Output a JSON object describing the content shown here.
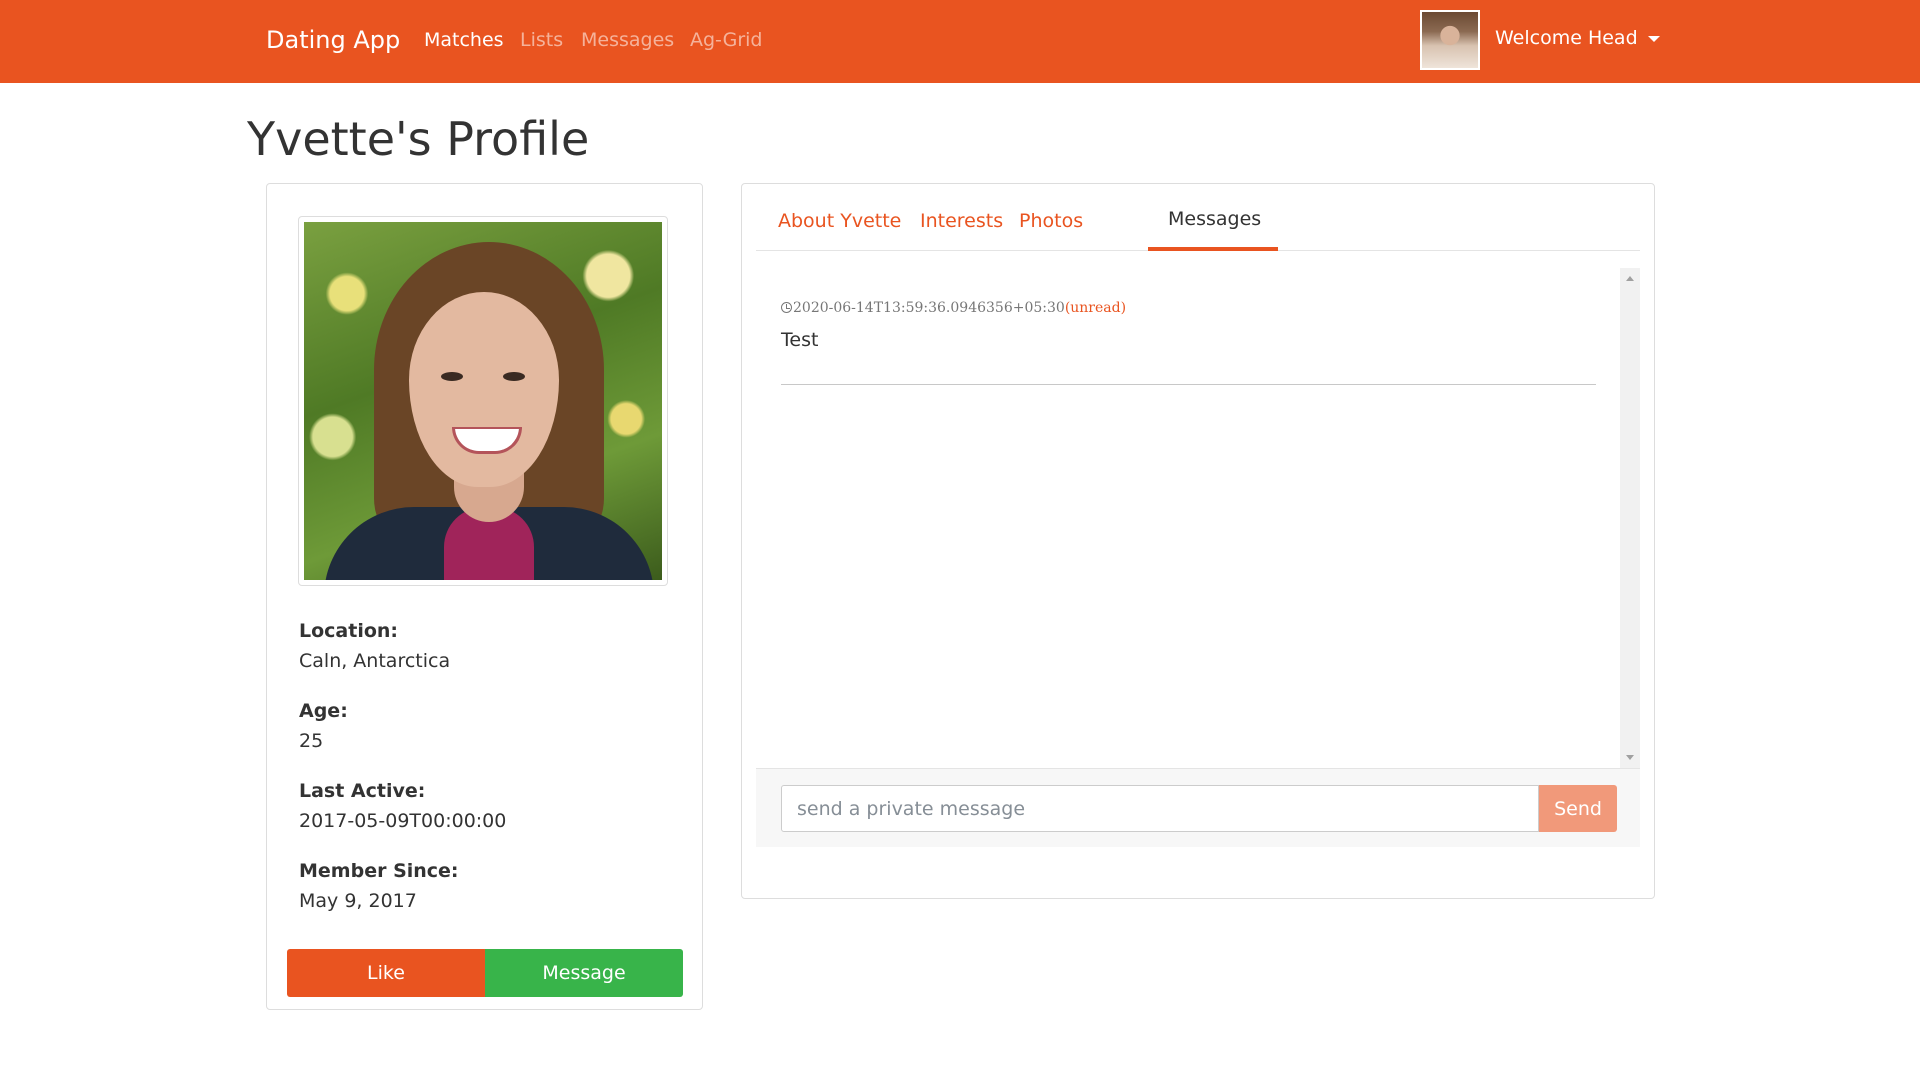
{
  "navbar": {
    "brand": "Dating App",
    "links": [
      {
        "label": "Matches",
        "active": true
      },
      {
        "label": "Lists",
        "active": false
      },
      {
        "label": "Messages",
        "active": false
      },
      {
        "label": "Ag-Grid",
        "active": false
      }
    ],
    "welcome": "Welcome Head",
    "accent_color": "#e95420"
  },
  "page": {
    "title": "Yvette's Profile"
  },
  "profile": {
    "details": [
      {
        "label": "Location:",
        "value": "Caln, Antarctica"
      },
      {
        "label": "Age:",
        "value": "25"
      },
      {
        "label": "Last Active:",
        "value": "2017-05-09T00:00:00"
      },
      {
        "label": "Member Since:",
        "value": "May 9, 2017"
      }
    ],
    "like_label": "Like",
    "message_label": "Message",
    "like_color": "#e95420",
    "message_color": "#38b44a"
  },
  "tabs": [
    {
      "label": "About Yvette",
      "active": false
    },
    {
      "label": "Interests",
      "active": false
    },
    {
      "label": "Photos",
      "active": false
    },
    {
      "label": "Messages",
      "active": true
    }
  ],
  "messages": [
    {
      "timestamp": "2020-06-14T13:59:36.0946356+05:30",
      "status": "(unread)",
      "text": "Test"
    }
  ],
  "compose": {
    "placeholder": "send a private message",
    "value": "",
    "send_label": "Send"
  }
}
